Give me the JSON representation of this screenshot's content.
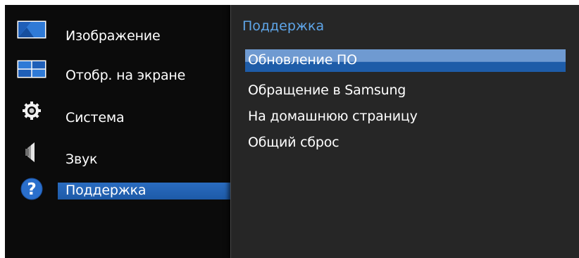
{
  "colors": {
    "panel_title": "#5ea5e8",
    "selection_blue": "#1e5ca8",
    "highlight_top": "#6f9ad1",
    "background": "#0b0b0b",
    "panel_background": "#262626"
  },
  "left_menu": {
    "items": [
      {
        "label": "Изображение",
        "icon": "picture-icon"
      },
      {
        "label": "Отобр. на экране",
        "icon": "screen-display-icon"
      },
      {
        "label": "Система",
        "icon": "gear-icon"
      },
      {
        "label": "Звук",
        "icon": "speaker-icon"
      },
      {
        "label": "Поддержка",
        "icon": "help-icon",
        "selected": true
      }
    ]
  },
  "right_panel": {
    "title": "Поддержка",
    "options": [
      {
        "label": "Обновление ПО",
        "highlighted": true
      },
      {
        "label": "Обращение в Samsung"
      },
      {
        "label": "На домашнюю страницу"
      },
      {
        "label": "Общий сброс"
      }
    ]
  }
}
